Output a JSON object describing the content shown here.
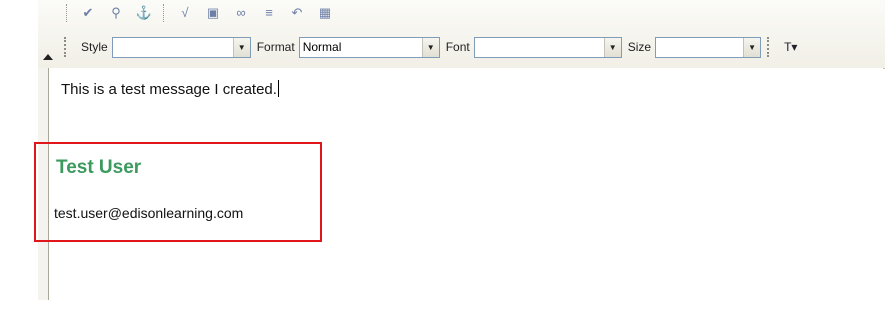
{
  "toolbar": {
    "row1_icons": [
      "spell-check-icon",
      "find-icon",
      "anchor-icon",
      "formula-icon",
      "image-icon",
      "link-icon",
      "list-icon",
      "undo-icon",
      "table-icon"
    ],
    "style": {
      "label": "Style",
      "value": ""
    },
    "format": {
      "label": "Format",
      "value": "Normal"
    },
    "font": {
      "label": "Font",
      "value": ""
    },
    "size": {
      "label": "Size",
      "value": ""
    }
  },
  "editor": {
    "message": "This is a test message I created.",
    "signature": {
      "name": "Test User",
      "email": "test.user@edisonlearning.com",
      "name_color": "#3c9a5f",
      "highlight_color": "#e0161b"
    }
  }
}
